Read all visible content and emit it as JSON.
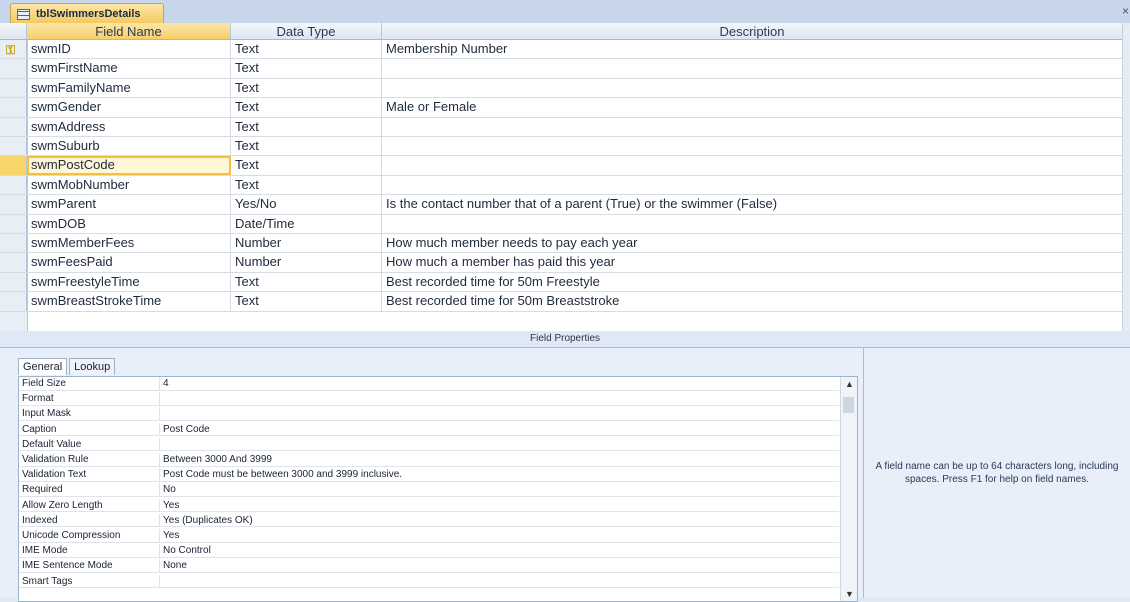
{
  "tab": {
    "title": "tblSwimmersDetails"
  },
  "grid": {
    "headers": {
      "field": "Field Name",
      "type": "Data Type",
      "desc": "Description"
    },
    "rows": [
      {
        "name": "swmID",
        "type": "Text",
        "desc": "Membership Number"
      },
      {
        "name": "swmFirstName",
        "type": "Text",
        "desc": ""
      },
      {
        "name": "swmFamilyName",
        "type": "Text",
        "desc": ""
      },
      {
        "name": "swmGender",
        "type": "Text",
        "desc": "Male or Female"
      },
      {
        "name": "swmAddress",
        "type": "Text",
        "desc": ""
      },
      {
        "name": "swmSuburb",
        "type": "Text",
        "desc": ""
      },
      {
        "name": "swmPostCode",
        "type": "Text",
        "desc": ""
      },
      {
        "name": "swmMobNumber",
        "type": "Text",
        "desc": ""
      },
      {
        "name": "swmParent",
        "type": "Yes/No",
        "desc": "Is the contact number that of a parent (True) or the swimmer (False)"
      },
      {
        "name": "swmDOB",
        "type": "Date/Time",
        "desc": ""
      },
      {
        "name": "swmMemberFees",
        "type": "Number",
        "desc": "How much member needs to pay each year"
      },
      {
        "name": "swmFeesPaid",
        "type": "Number",
        "desc": "How much a member has paid this year"
      },
      {
        "name": "swmFreestyleTime",
        "type": "Text",
        "desc": "Best recorded time for 50m Freestyle"
      },
      {
        "name": "swmBreastStrokeTime",
        "type": "Text",
        "desc": "Best recorded time for 50m Breaststroke"
      }
    ]
  },
  "field_properties": {
    "title": "Field Properties",
    "tabs": [
      "General",
      "Lookup"
    ],
    "rows": [
      {
        "k": "Field Size",
        "v": "4"
      },
      {
        "k": "Format",
        "v": ""
      },
      {
        "k": "Input Mask",
        "v": ""
      },
      {
        "k": "Caption",
        "v": "Post Code"
      },
      {
        "k": "Default Value",
        "v": ""
      },
      {
        "k": "Validation Rule",
        "v": "Between 3000 And 3999"
      },
      {
        "k": "Validation Text",
        "v": "Post Code must be between 3000 and 3999 inclusive."
      },
      {
        "k": "Required",
        "v": "No"
      },
      {
        "k": "Allow Zero Length",
        "v": "Yes"
      },
      {
        "k": "Indexed",
        "v": "Yes (Duplicates OK)"
      },
      {
        "k": "Unicode Compression",
        "v": "Yes"
      },
      {
        "k": "IME Mode",
        "v": "No Control"
      },
      {
        "k": "IME Sentence Mode",
        "v": "None"
      },
      {
        "k": "Smart Tags",
        "v": ""
      }
    ],
    "help": "A field name can be up to 64 characters long, including spaces. Press F1 for help on field names."
  }
}
